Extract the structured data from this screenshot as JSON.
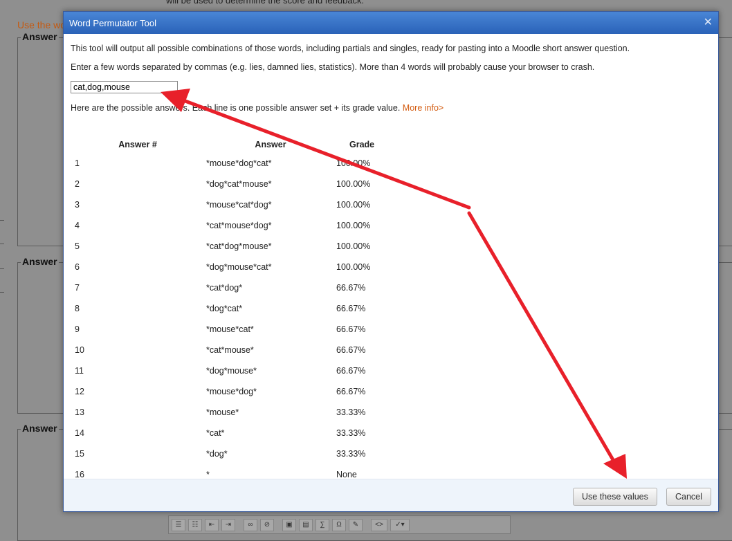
{
  "background": {
    "top_text": "will be used to determine the score and feedback.",
    "use_text": "Use the wo",
    "answer_legend_1": "Answer",
    "answer_legend_2": "Answer",
    "answer_legend_3": "Answer"
  },
  "dialog": {
    "title": "Word Permutator Tool",
    "description": "This tool will output all possible combinations of those words, including partials and singles, ready for pasting into a Moodle short answer question.",
    "instruction": "Enter a few words separated by commas (e.g. lies, damned lies, statistics). More than 4 words will probably cause your browser to crash.",
    "input_value": "cat,dog,mouse",
    "result_text": "Here are the possible answers. Each line is one possible answer set + its grade value.",
    "more_info_link": "More info>",
    "table": {
      "headers": [
        "Answer #",
        "Answer",
        "Grade"
      ],
      "rows": [
        [
          "1",
          "*mouse*dog*cat*",
          "100.00%"
        ],
        [
          "2",
          "*dog*cat*mouse*",
          "100.00%"
        ],
        [
          "3",
          "*mouse*cat*dog*",
          "100.00%"
        ],
        [
          "4",
          "*cat*mouse*dog*",
          "100.00%"
        ],
        [
          "5",
          "*cat*dog*mouse*",
          "100.00%"
        ],
        [
          "6",
          "*dog*mouse*cat*",
          "100.00%"
        ],
        [
          "7",
          "*cat*dog*",
          "66.67%"
        ],
        [
          "8",
          "*dog*cat*",
          "66.67%"
        ],
        [
          "9",
          "*mouse*cat*",
          "66.67%"
        ],
        [
          "10",
          "*cat*mouse*",
          "66.67%"
        ],
        [
          "11",
          "*dog*mouse*",
          "66.67%"
        ],
        [
          "12",
          "*mouse*dog*",
          "66.67%"
        ],
        [
          "13",
          "*mouse*",
          "33.33%"
        ],
        [
          "14",
          "*cat*",
          "33.33%"
        ],
        [
          "15",
          "*dog*",
          "33.33%"
        ],
        [
          "16",
          "*",
          "None"
        ]
      ]
    },
    "use_button": "Use these values",
    "cancel_button": "Cancel"
  },
  "toolbar_icons": [
    "bullet-list-icon",
    "numbered-list-icon",
    "outdent-icon",
    "indent-icon",
    "link-icon",
    "unlink-icon",
    "image-icon",
    "media-icon",
    "math-icon",
    "omega-icon",
    "edit-icon",
    "html-icon",
    "spellcheck-icon"
  ],
  "colors": {
    "titlebar": "#2a62b8",
    "link": "#d35a0e",
    "annotation_arrow": "#e8202a",
    "overlay": "#8f8f8f"
  }
}
